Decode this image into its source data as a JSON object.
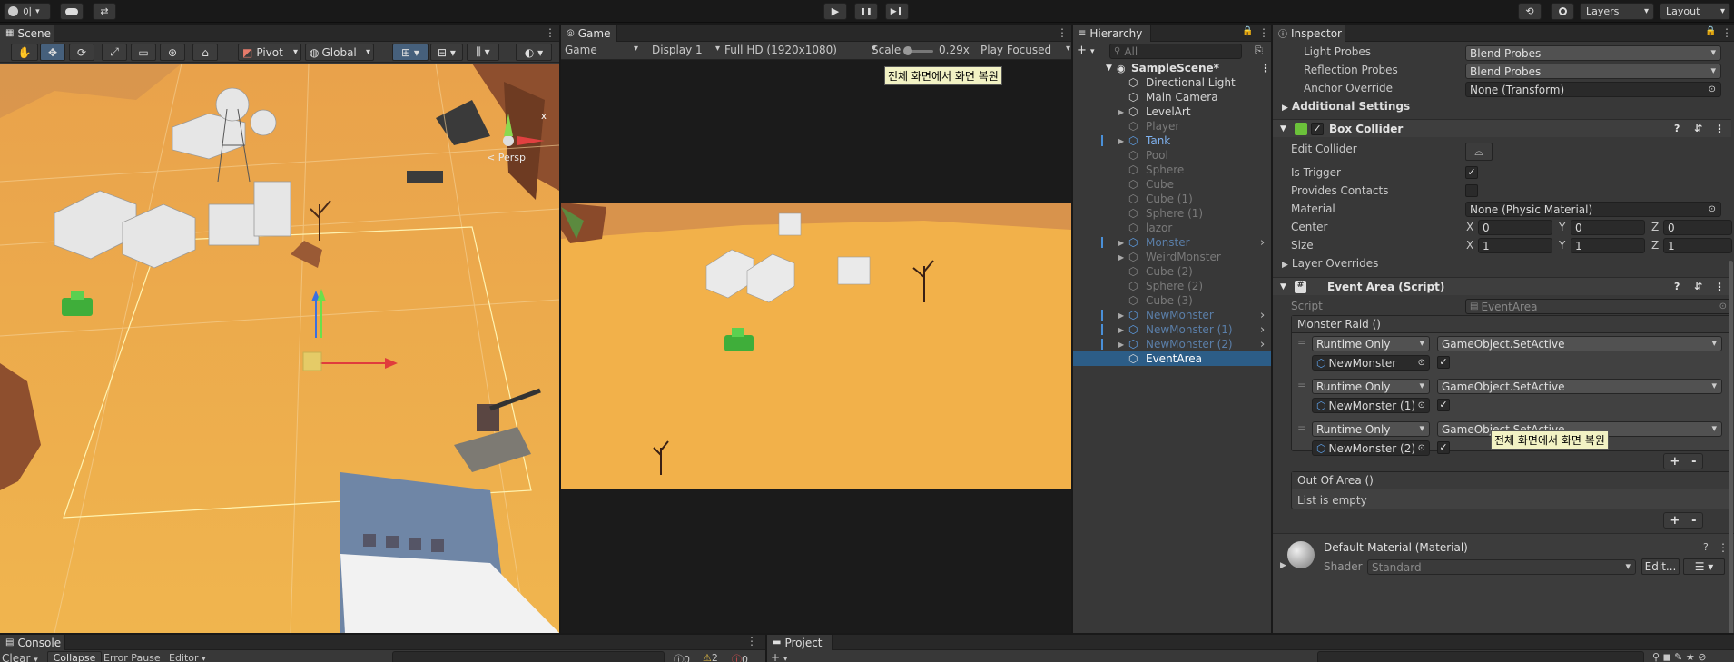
{
  "toolbar": {
    "account": "이",
    "play": "▶",
    "pause": "❚❚",
    "step": "▶❚",
    "layers": "Layers",
    "layout": "Layout"
  },
  "scene": {
    "tab": "Scene",
    "pivot": "Pivot",
    "global": "Global",
    "persp": "< Persp",
    "axis_x": "x"
  },
  "game": {
    "tab": "Game",
    "mode": "Game",
    "display": "Display 1",
    "resolution": "Full HD (1920x1080)",
    "scale_label": "Scale",
    "scale_value": "0.29x",
    "scale_fraction": 0.05,
    "play_focused": "Play Focused",
    "tooltip": "전체 화면에서 화면 복원"
  },
  "hierarchy": {
    "tab": "Hierarchy",
    "search_placeholder": "All",
    "scene": "SampleScene*",
    "items": [
      {
        "label": "Directional Light",
        "style": "normal",
        "arrow": false,
        "mark": false,
        "sub": false
      },
      {
        "label": "Main Camera",
        "style": "normal",
        "arrow": false,
        "mark": false,
        "sub": false
      },
      {
        "label": "LevelArt",
        "style": "normal",
        "arrow": true,
        "mark": false,
        "sub": false
      },
      {
        "label": "Player",
        "style": "dim",
        "arrow": false,
        "mark": false,
        "sub": false
      },
      {
        "label": "Tank",
        "style": "prefab",
        "arrow": true,
        "mark": true,
        "sub": false
      },
      {
        "label": "Pool",
        "style": "dim",
        "arrow": false,
        "mark": false,
        "sub": false
      },
      {
        "label": "Sphere",
        "style": "dim",
        "arrow": false,
        "mark": false,
        "sub": false
      },
      {
        "label": "Cube",
        "style": "dim",
        "arrow": false,
        "mark": false,
        "sub": false
      },
      {
        "label": "Cube (1)",
        "style": "dim",
        "arrow": false,
        "mark": false,
        "sub": false
      },
      {
        "label": "Sphere (1)",
        "style": "dim",
        "arrow": false,
        "mark": false,
        "sub": false
      },
      {
        "label": "lazor",
        "style": "dim",
        "arrow": false,
        "mark": false,
        "sub": false
      },
      {
        "label": "Monster",
        "style": "prefabdim",
        "arrow": true,
        "mark": true,
        "sub": true
      },
      {
        "label": "WeirdMonster",
        "style": "dim",
        "arrow": true,
        "mark": false,
        "sub": false
      },
      {
        "label": "Cube (2)",
        "style": "dim",
        "arrow": false,
        "mark": false,
        "sub": false
      },
      {
        "label": "Sphere (2)",
        "style": "dim",
        "arrow": false,
        "mark": false,
        "sub": false
      },
      {
        "label": "Cube (3)",
        "style": "dim",
        "arrow": false,
        "mark": false,
        "sub": false
      },
      {
        "label": "NewMonster",
        "style": "prefabdim",
        "arrow": true,
        "mark": true,
        "sub": true
      },
      {
        "label": "NewMonster (1)",
        "style": "prefabdim",
        "arrow": true,
        "mark": true,
        "sub": true
      },
      {
        "label": "NewMonster (2)",
        "style": "prefabdim",
        "arrow": true,
        "mark": true,
        "sub": true
      },
      {
        "label": "EventArea",
        "style": "selected",
        "arrow": false,
        "mark": false,
        "sub": false
      }
    ]
  },
  "inspector": {
    "tab": "Inspector",
    "light_probes": {
      "label": "Light Probes",
      "value": "Blend Probes"
    },
    "reflection_probes": {
      "label": "Reflection Probes",
      "value": "Blend Probes"
    },
    "anchor_override": {
      "label": "Anchor Override",
      "value": "None (Transform)"
    },
    "additional_settings": "Additional Settings",
    "box_collider": {
      "title": "Box Collider",
      "edit_collider": "Edit Collider",
      "is_trigger": "Is Trigger",
      "is_trigger_checked": true,
      "provides_contacts": "Provides Contacts",
      "provides_contacts_checked": false,
      "material_label": "Material",
      "material_value": "None (Physic Material)",
      "center_label": "Center",
      "center": {
        "x": "0",
        "y": "0",
        "z": "0"
      },
      "size_label": "Size",
      "size": {
        "x": "1",
        "y": "1",
        "z": "1"
      },
      "layer_overrides": "Layer Overrides"
    },
    "event_area": {
      "title": "Event Area (Script)",
      "script_label": "Script",
      "script_value": "EventArea",
      "monster_raid": {
        "header": "Monster Raid ()",
        "entries": [
          {
            "runtime": "Runtime Only",
            "function": "GameObject.SetActive",
            "target": "NewMonster",
            "checked": true
          },
          {
            "runtime": "Runtime Only",
            "function": "GameObject.SetActive",
            "target": "NewMonster (1)",
            "checked": true
          },
          {
            "runtime": "Runtime Only",
            "function": "GameObject.SetActive",
            "target": "NewMonster (2)",
            "checked": true
          }
        ]
      },
      "out_of_area": {
        "header": "Out Of Area ()",
        "empty": "List is empty"
      },
      "plus": "+",
      "minus": "-"
    },
    "material": {
      "name": "Default-Material (Material)",
      "shader_label": "Shader",
      "shader_value": "Standard",
      "edit": "Edit..."
    },
    "tooltip": "전체 화면에서 화면 복원"
  },
  "console": {
    "tab": "Console",
    "clear": "Clear",
    "collapse": "Collapse",
    "error_pause": "Error Pause",
    "editor": "Editor",
    "count_info": "0",
    "count_warn": "2",
    "count_error": "0"
  },
  "project": {
    "tab": "Project"
  }
}
